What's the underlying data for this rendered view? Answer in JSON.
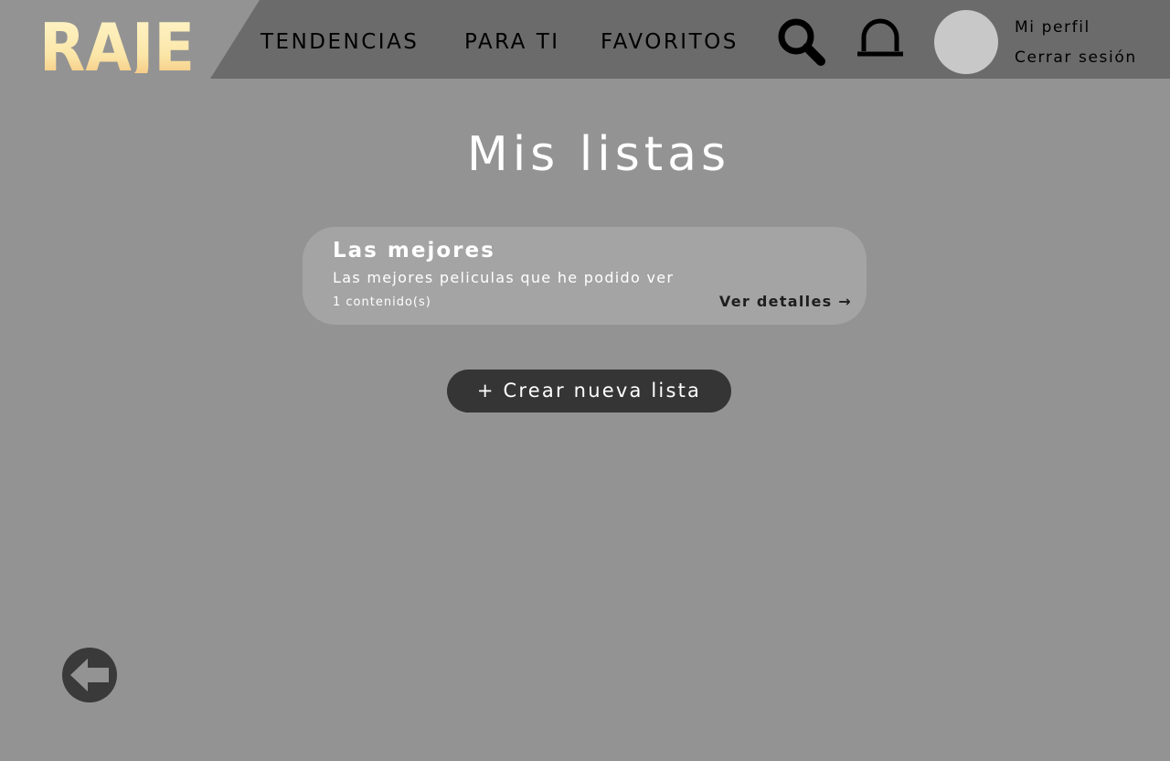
{
  "header": {
    "logo_text": "RAJE",
    "nav": {
      "tendencias": "TENDENCIAS",
      "para_ti": "PARA TI",
      "favoritos": "FAVORITOS"
    },
    "icons": {
      "search": "search-icon",
      "notifications": "bell-icon"
    },
    "profile_label": "Mi perfil",
    "logout_label": "Cerrar sesión"
  },
  "main": {
    "title": "Mis listas",
    "lists": [
      {
        "name": "Las mejores",
        "description": "Las mejores peliculas que he podido ver",
        "count": "1 contenido(s)",
        "details_label": "Ver detalles →"
      }
    ],
    "create_label": "+ Crear nueva lista",
    "back_icon": "back-arrow-icon"
  },
  "colors": {
    "background": "#939393",
    "header_bar": "#6b6b6b",
    "card": "#a4a4a4",
    "button": "#353535",
    "logo_top": "#fff5c9",
    "logo_bottom": "#f5c87a"
  }
}
